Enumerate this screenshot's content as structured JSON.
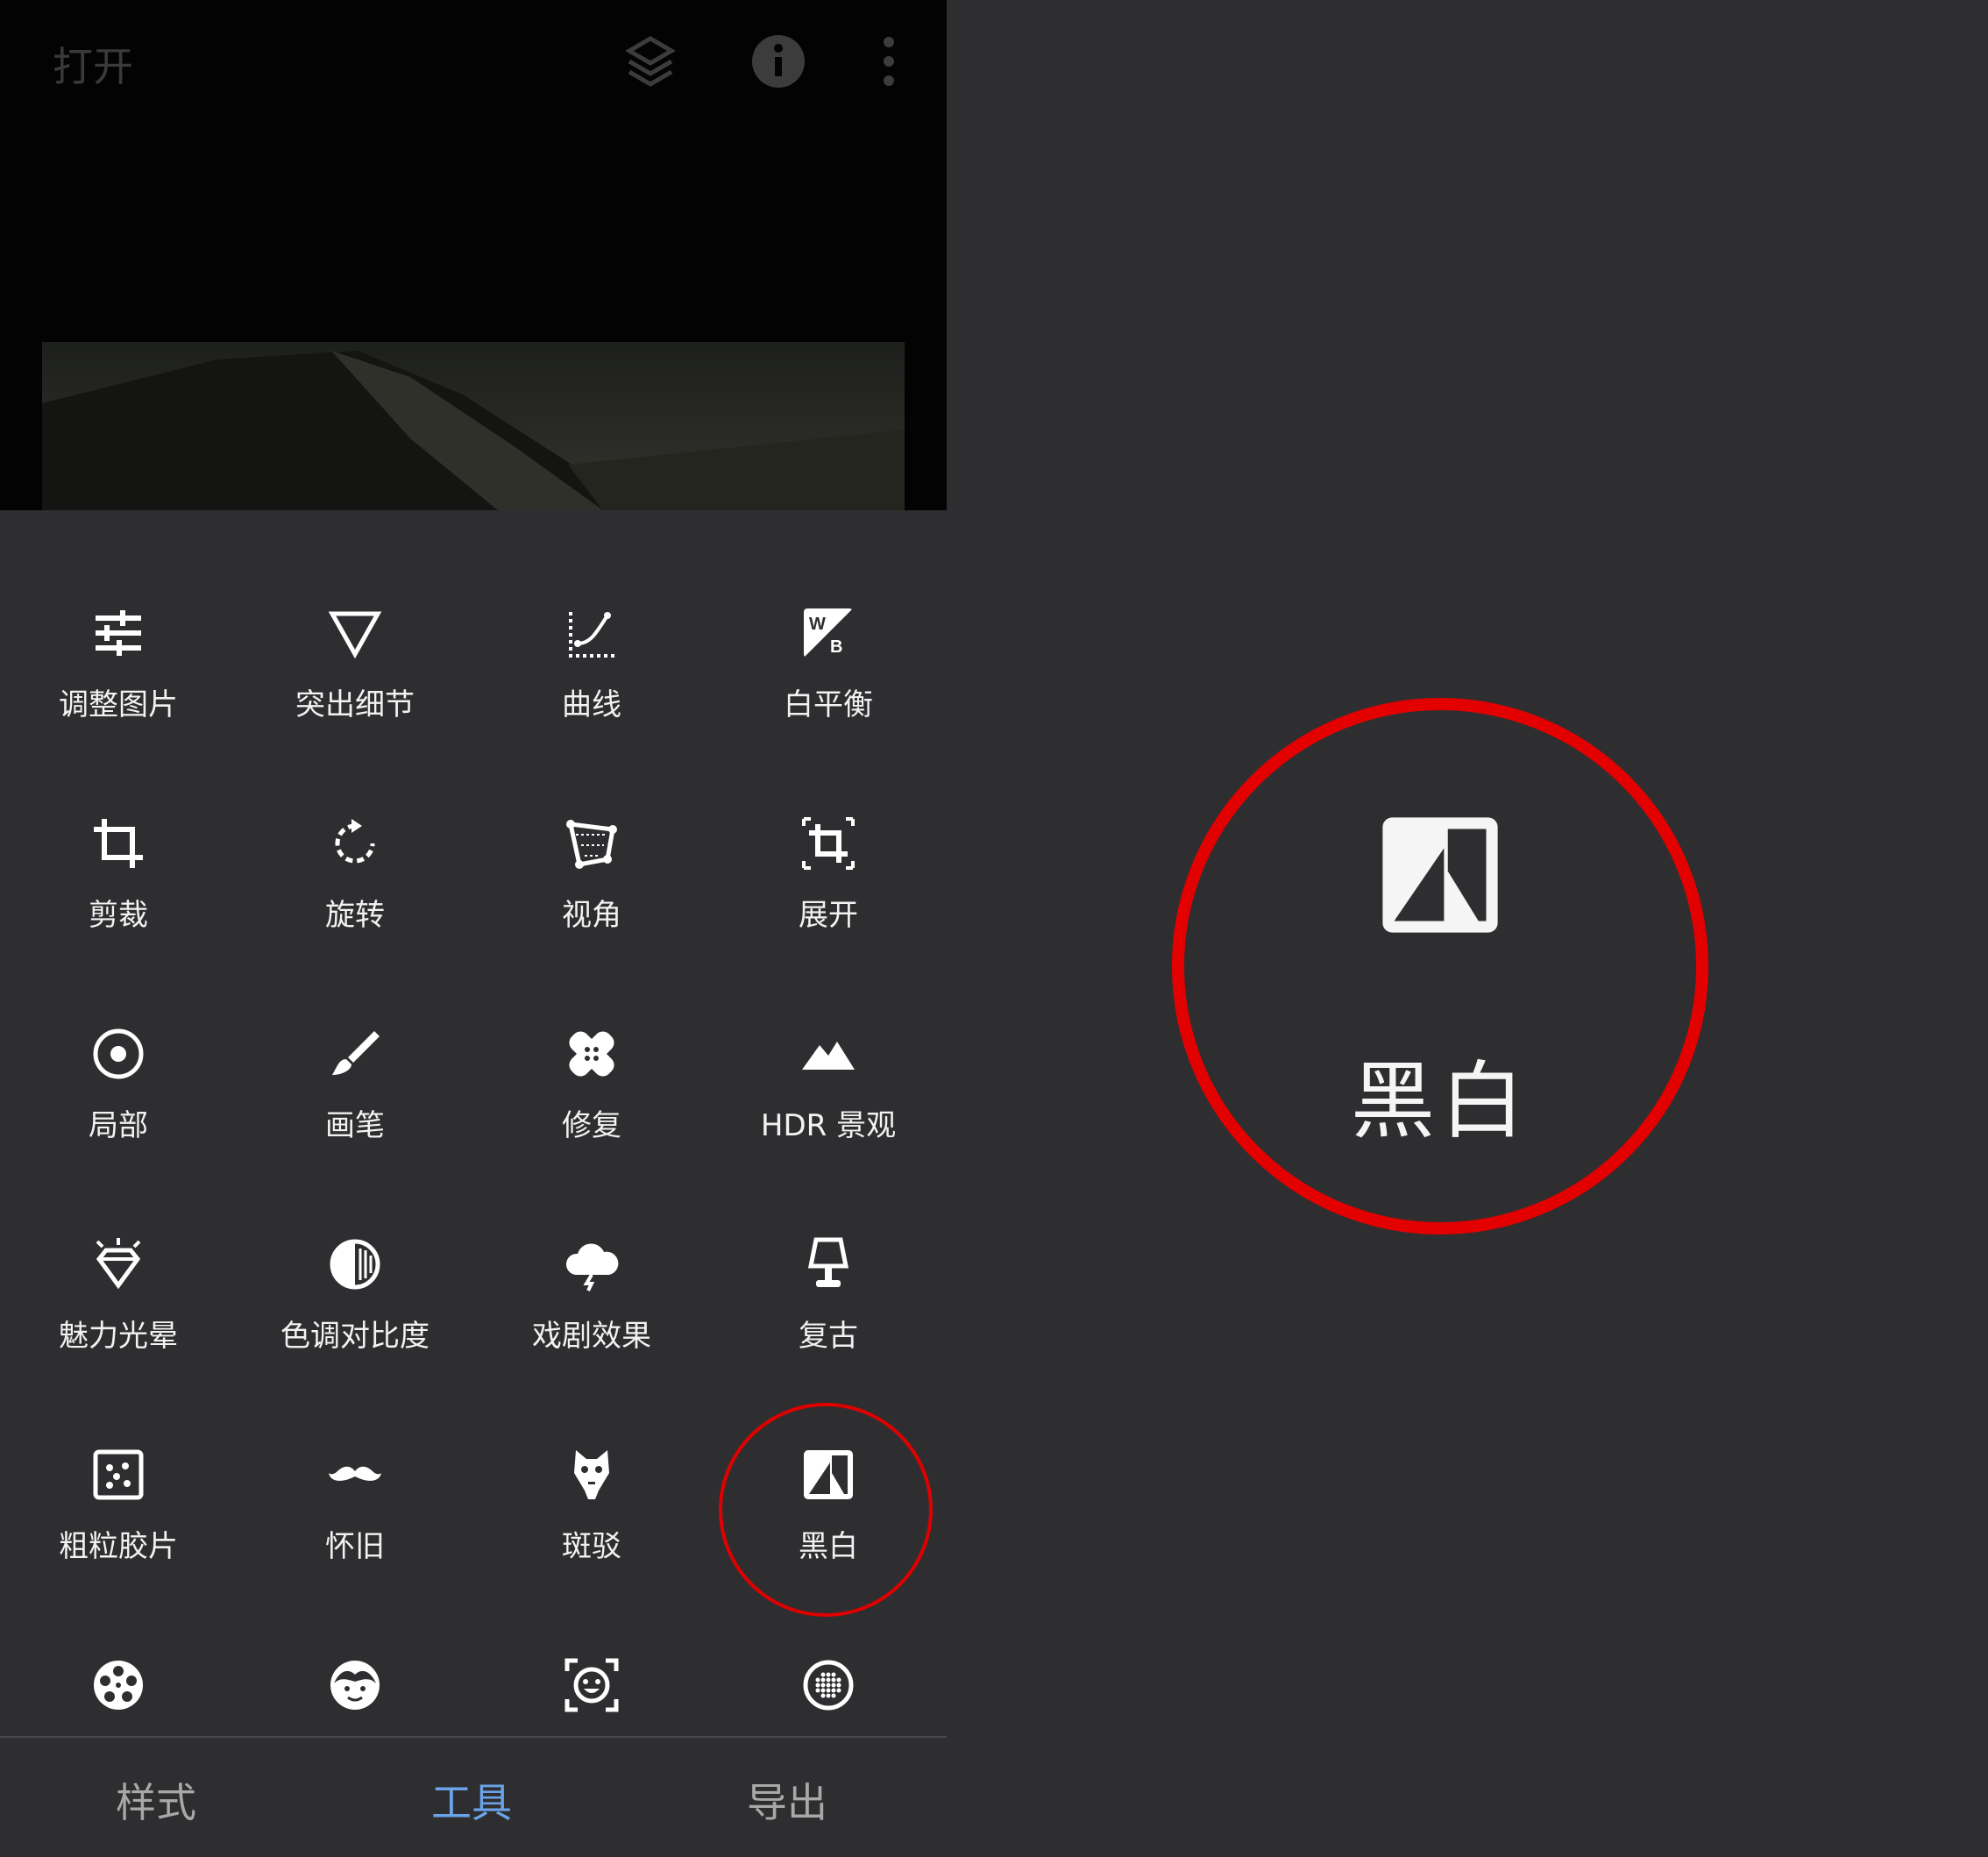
{
  "topbar": {
    "title": "打开",
    "icons": [
      "layers-refresh-icon",
      "info-icon",
      "more-vert-icon"
    ]
  },
  "tools": [
    {
      "label": "调整图片",
      "icon": "tune-icon"
    },
    {
      "label": "突出细节",
      "icon": "details-triangle-icon"
    },
    {
      "label": "曲线",
      "icon": "curves-icon"
    },
    {
      "label": "白平衡",
      "icon": "white-balance-icon"
    },
    {
      "label": "剪裁",
      "icon": "crop-icon"
    },
    {
      "label": "旋转",
      "icon": "rotate-icon"
    },
    {
      "label": "视角",
      "icon": "perspective-icon"
    },
    {
      "label": "展开",
      "icon": "expand-icon"
    },
    {
      "label": "局部",
      "icon": "selective-icon"
    },
    {
      "label": "画笔",
      "icon": "brush-icon"
    },
    {
      "label": "修复",
      "icon": "healing-icon"
    },
    {
      "label": "HDR 景观",
      "icon": "hdr-mountain-icon"
    },
    {
      "label": "魅力光晕",
      "icon": "glamour-glow-icon"
    },
    {
      "label": "色调对比度",
      "icon": "tonal-contrast-icon"
    },
    {
      "label": "戏剧效果",
      "icon": "drama-cloud-icon"
    },
    {
      "label": "复古",
      "icon": "vintage-lamp-icon"
    },
    {
      "label": "粗粒胶片",
      "icon": "grainy-film-icon"
    },
    {
      "label": "怀旧",
      "icon": "mustache-icon"
    },
    {
      "label": "斑驳",
      "icon": "grunge-icon"
    },
    {
      "label": "黑白",
      "icon": "black-white-icon"
    },
    {
      "label": "",
      "icon": "film-reel-icon"
    },
    {
      "label": "",
      "icon": "face-icon"
    },
    {
      "label": "",
      "icon": "face-frame-icon"
    },
    {
      "label": "",
      "icon": "dots-circle-icon"
    }
  ],
  "bottom_nav": [
    {
      "label": "样式",
      "active": false
    },
    {
      "label": "工具",
      "active": true
    },
    {
      "label": "导出",
      "active": false
    }
  ],
  "zoom": {
    "label": "黑白",
    "icon": "black-white-icon"
  },
  "colors": {
    "highlight": "#e00000",
    "active_tab": "#6ba3e8",
    "panel_bg": "#2e2e30"
  }
}
